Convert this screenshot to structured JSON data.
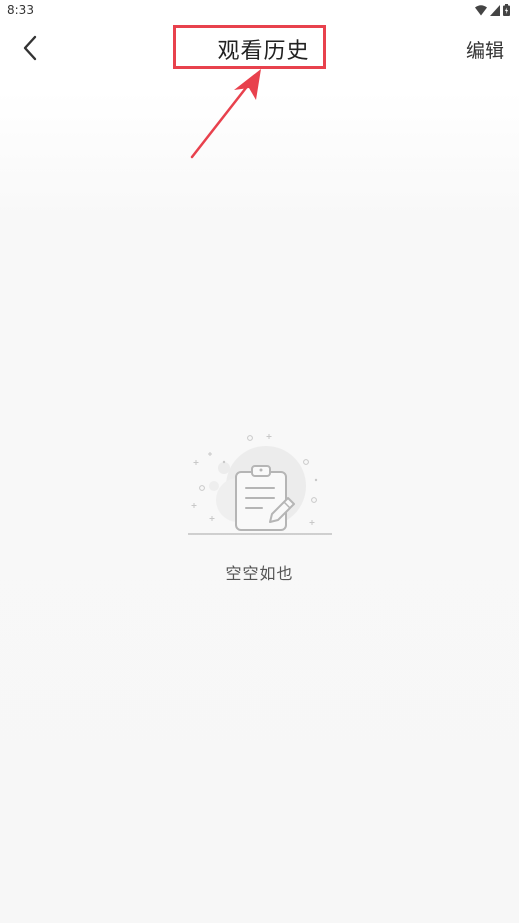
{
  "status_bar": {
    "time": "8:33",
    "icons": [
      "wifi-icon",
      "signal-icon",
      "battery-icon"
    ]
  },
  "header": {
    "back_icon": "chevron-left-icon",
    "title": "观看历史",
    "edit_label": "编辑"
  },
  "annotation": {
    "highlight_color": "#e8414d"
  },
  "empty_state": {
    "illustration": "clipboard-edit-icon",
    "message": "空空如也"
  }
}
